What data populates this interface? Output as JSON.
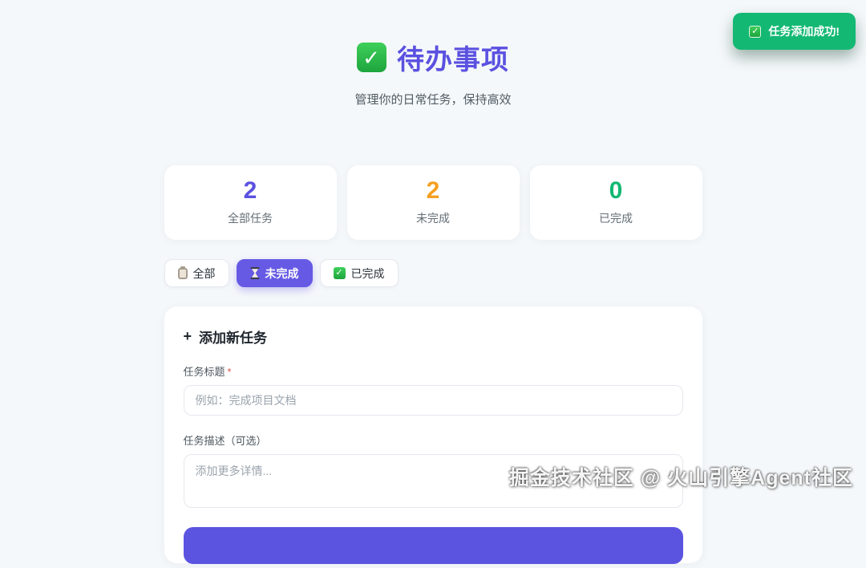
{
  "toast": {
    "message": "任务添加成功!",
    "icon": "check-icon",
    "bg_color": "#13b873"
  },
  "header": {
    "title": "待办事项",
    "title_icon": "check-icon",
    "subtitle": "管理你的日常任务，保持高效",
    "title_color": "#5b51e0"
  },
  "stats": [
    {
      "value": "2",
      "label": "全部任务",
      "color": "#5b51e0"
    },
    {
      "value": "2",
      "label": "未完成",
      "color": "#f6a021"
    },
    {
      "value": "0",
      "label": "已完成",
      "color": "#13b873"
    }
  ],
  "filters": [
    {
      "label": "全部",
      "icon": "clipboard-icon",
      "active": false
    },
    {
      "label": "未完成",
      "icon": "hourglass-icon",
      "active": true
    },
    {
      "label": "已完成",
      "icon": "check-icon",
      "active": false
    }
  ],
  "form": {
    "title": "添加新任务",
    "title_icon": "+",
    "fields": [
      {
        "label": "任务标题",
        "required": "*",
        "placeholder": "例如：完成项目文档",
        "value": "",
        "type": "input"
      },
      {
        "label": "任务描述（可选）",
        "required": "",
        "placeholder": "添加更多详情...",
        "value": "",
        "type": "textarea"
      }
    ]
  },
  "watermark": "掘金技术社区 @ 火山引擎Agent社区",
  "colors": {
    "page_bg": "#f5f8fa",
    "accent": "#5b51e0",
    "active_filter": "#665ae4",
    "orange": "#f6a021",
    "green": "#13b873"
  }
}
